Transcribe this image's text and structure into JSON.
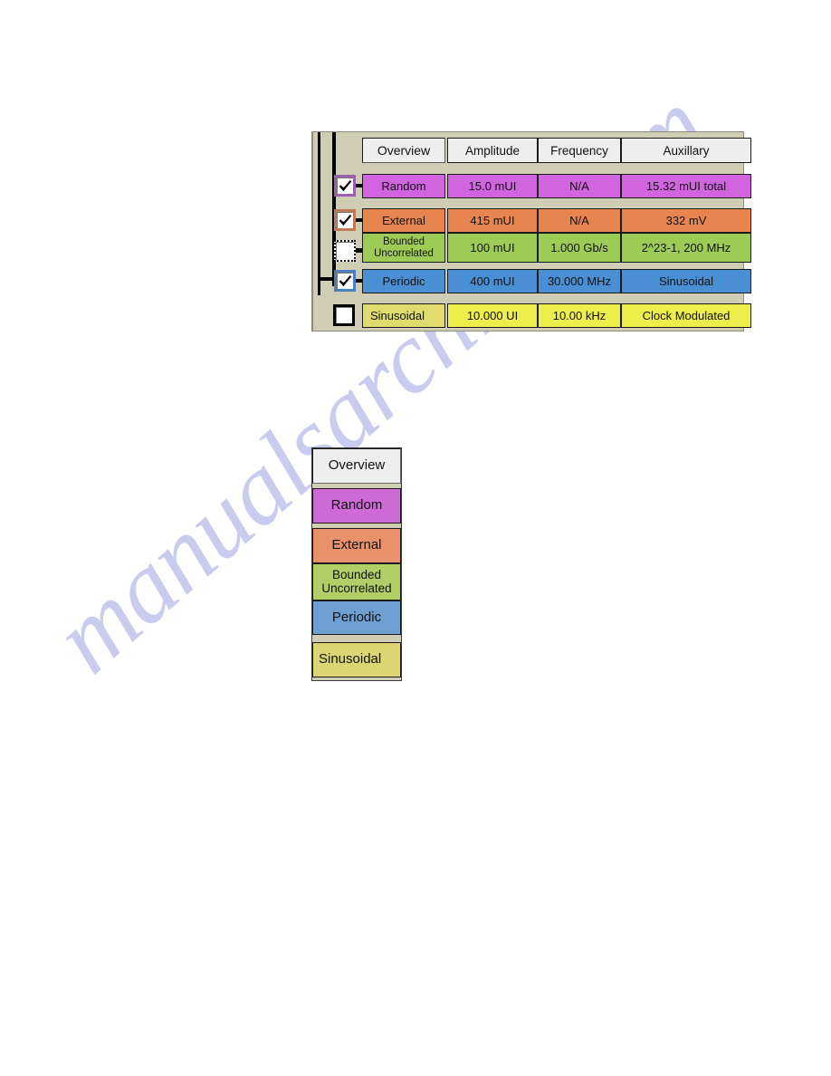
{
  "watermark": {
    "text": "manualsarchive.com"
  },
  "jitter_table": {
    "overview_tab_label": "Overview",
    "column_headers": [
      "Amplitude",
      "Frequency",
      "Auxillary"
    ],
    "rows": [
      {
        "id": "random",
        "label": "Random",
        "label_lines": [
          "Random"
        ],
        "checked": true,
        "checkbox_state": "checked",
        "color": "#d264e0",
        "border_color": "#9b5fb0",
        "amplitude": "15.0 mUI",
        "frequency": "N/A",
        "auxillary": "15.32 mUI total"
      },
      {
        "id": "external",
        "label": "External",
        "label_lines": [
          "External"
        ],
        "checked": true,
        "checkbox_state": "checked",
        "color": "#e8854f",
        "border_color": "#c07a5a",
        "amplitude": "415 mUI",
        "frequency": "N/A",
        "auxillary": "332 mV"
      },
      {
        "id": "bounded-uncorrelated",
        "label": "Bounded Uncorrelated",
        "label_lines": [
          "Bounded",
          "Uncorrelated"
        ],
        "checked": false,
        "checkbox_state": "unchecked-focused",
        "color": "#9ccc55",
        "border_color": "#000000",
        "amplitude": "100 mUI",
        "frequency": "1.000 Gb/s",
        "auxillary": "2^23-1, 200 MHz"
      },
      {
        "id": "periodic",
        "label": "Periodic",
        "label_lines": [
          "Periodic"
        ],
        "checked": true,
        "checkbox_state": "checked",
        "color": "#4a8fd4",
        "border_color": "#4a7fbf",
        "amplitude": "400 mUI",
        "frequency": "30.000 MHz",
        "auxillary": "Sinusoidal"
      },
      {
        "id": "sinusoidal",
        "label": "Sinusoidal",
        "label_lines": [
          "Sinusoidal"
        ],
        "checked": false,
        "checkbox_state": "unchecked",
        "color": "#eded4b",
        "border_color": "#000000",
        "amplitude": "10.000 UI",
        "frequency": "10.00 kHz",
        "auxillary": "Clock Modulated"
      }
    ]
  },
  "legend": {
    "items": [
      {
        "id": "overview",
        "label": "Overview",
        "label_lines": [
          "Overview"
        ],
        "color": "#eeeeee"
      },
      {
        "id": "random",
        "label": "Random",
        "label_lines": [
          "Random"
        ],
        "color": "#cd6ad6"
      },
      {
        "id": "external",
        "label": "External",
        "label_lines": [
          "External"
        ],
        "color": "#e9916b"
      },
      {
        "id": "bounded-uncorrelated",
        "label": "Bounded Uncorrelated",
        "label_lines": [
          "Bounded",
          "Uncorrelated"
        ],
        "color": "#b2ce67"
      },
      {
        "id": "periodic",
        "label": "Periodic",
        "label_lines": [
          "Periodic"
        ],
        "color": "#6e9fd2"
      },
      {
        "id": "sinusoidal",
        "label": "Sinusoidal",
        "label_lines": [
          "Sinusoidal"
        ],
        "color": "#ddd573"
      }
    ]
  }
}
